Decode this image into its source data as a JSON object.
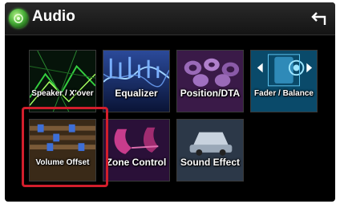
{
  "header": {
    "title": "Audio"
  },
  "menu": {
    "items": [
      {
        "label": "Speaker / X'over"
      },
      {
        "label": "Equalizer"
      },
      {
        "label": "Position/DTA"
      },
      {
        "label": "Fader / Balance"
      },
      {
        "label": "Volume Offset"
      },
      {
        "label": "Zone Control"
      },
      {
        "label": "Sound Effect"
      }
    ]
  },
  "colors": {
    "highlight": "#d21e2c",
    "background": "#000000"
  }
}
